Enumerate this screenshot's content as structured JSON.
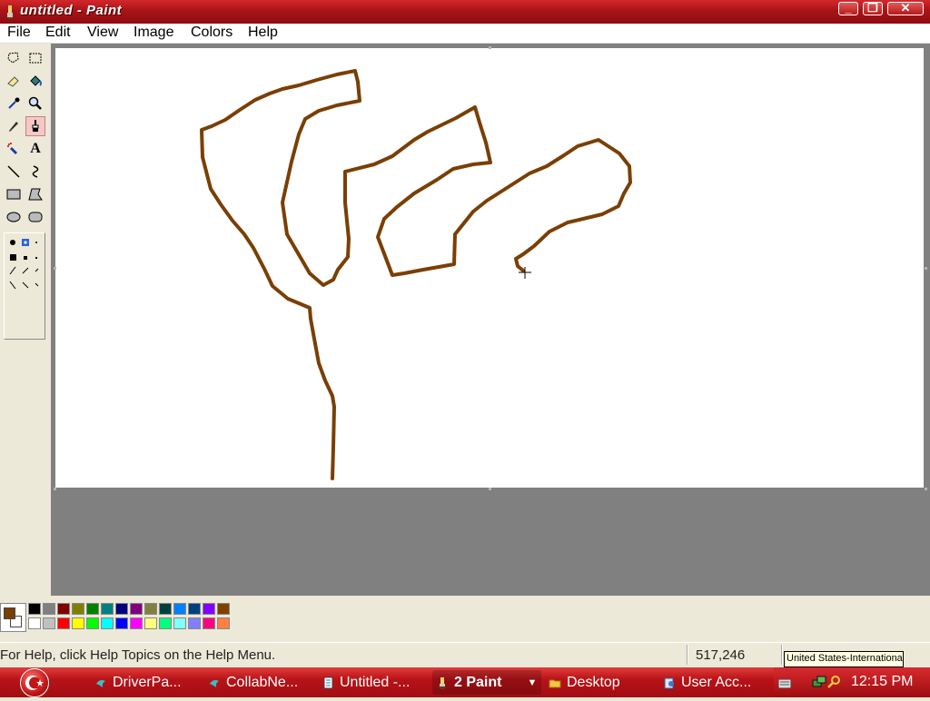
{
  "window": {
    "title": "untitled - Paint"
  },
  "menu": [
    "File",
    "Edit",
    "View",
    "Image",
    "Colors",
    "Help"
  ],
  "tools": [
    "free-select-icon",
    "select-icon",
    "eraser-icon",
    "fill-icon",
    "color-picker-icon",
    "magnifier-icon",
    "pencil-icon",
    "brush-icon",
    "airbrush-icon",
    "text-icon",
    "line-icon",
    "curve-icon",
    "rectangle-icon",
    "polygon-icon",
    "ellipse-icon",
    "rounded-rectangle-icon"
  ],
  "active_tool": "brush-icon",
  "colors": {
    "foreground": "#7a3f05",
    "background": "#ffffff",
    "palette_top": [
      "#000000",
      "#808080",
      "#800000",
      "#808000",
      "#008000",
      "#008080",
      "#000080",
      "#800080",
      "#808040",
      "#004040",
      "#0080ff",
      "#004080",
      "#8000ff",
      "#804000"
    ],
    "palette_bottom": [
      "#ffffff",
      "#c0c0c0",
      "#ff0000",
      "#ffff00",
      "#00ff00",
      "#00ffff",
      "#0000ff",
      "#ff00ff",
      "#ffff80",
      "#00ff80",
      "#80ffff",
      "#8080ff",
      "#ff0080",
      "#ff8040"
    ]
  },
  "status": {
    "help": "For Help, click Help Topics on the Help Menu.",
    "coords": "517,246"
  },
  "tooltip": "United States-International",
  "taskbar": {
    "tasks": [
      {
        "label": "DriverPa...",
        "icon": "bird-icon"
      },
      {
        "label": "CollabNe...",
        "icon": "bird-icon"
      },
      {
        "label": "Untitled -...",
        "icon": "document-icon"
      },
      {
        "label": "2 Paint",
        "icon": "paint-icon",
        "active": true
      },
      {
        "label": "Desktop",
        "icon": "folder-icon"
      },
      {
        "label": "User Acc...",
        "icon": "user-accounts-icon"
      }
    ],
    "clock": "12:15 PM"
  }
}
